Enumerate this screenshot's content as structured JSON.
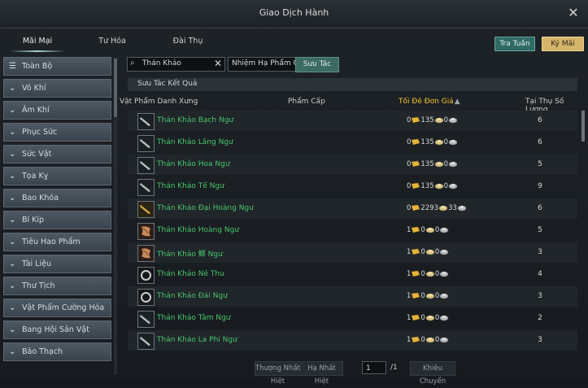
{
  "window": {
    "title": "Giao Dịch Hành",
    "close": "✕"
  },
  "tabs": [
    {
      "label": "Mãi Mại",
      "active": true
    },
    {
      "label": "Tư Hóa",
      "active": false
    },
    {
      "label": "Đài Thụ",
      "active": false
    }
  ],
  "top_buttons": {
    "tra_tuan": "Tra Tuần",
    "ky_mai": "Ký Mãi"
  },
  "sidebar": {
    "items": [
      {
        "label": "Toàn Bộ",
        "icon": "list-icon"
      },
      {
        "label": "Võ Khí",
        "icon": "chevron-down-icon"
      },
      {
        "label": "Âm Khí",
        "icon": "chevron-down-icon"
      },
      {
        "label": "Phục Sức",
        "icon": "chevron-down-icon"
      },
      {
        "label": "Sức Vật",
        "icon": "chevron-down-icon"
      },
      {
        "label": "Tọa Kỵ",
        "icon": "chevron-down-icon"
      },
      {
        "label": "Bao Khỏa",
        "icon": "chevron-down-icon"
      },
      {
        "label": "Bí Kíp",
        "icon": "chevron-down-icon"
      },
      {
        "label": "Tiêu Hao Phẩm",
        "icon": "chevron-down-icon"
      },
      {
        "label": "Tài Liệu",
        "icon": "chevron-down-icon"
      },
      {
        "label": "Thư Tịch",
        "icon": "chevron-down-icon"
      },
      {
        "label": "Vật Phẩm Cường Hóa",
        "icon": "chevron-down-icon"
      },
      {
        "label": "Bang Hội Sản Vật",
        "icon": "chevron-down-icon"
      },
      {
        "label": "Bảo Thạch",
        "icon": "chevron-down-icon"
      }
    ]
  },
  "search": {
    "value": "Thán Khảo",
    "clear": "✕",
    "filter": "Nhiệm Hạ Phẩm Ch",
    "button": "Sưu Tác"
  },
  "results": {
    "label": "Sưu Tác Kết Quả",
    "columns": {
      "item": "Vật Phẩm Danh Xưng",
      "grade": "Phẩm Cấp",
      "price": "Tối Đê Đơn Giá",
      "qty": "Tại Thụ Số Lượng"
    },
    "rows": [
      {
        "name": "Thán Khảo Bạch Ngư",
        "g": "0",
        "s": "135",
        "c": "0",
        "qty": "6",
        "icon": "sword-icon"
      },
      {
        "name": "Thán Khảo Lăng Ngư",
        "g": "0",
        "s": "135",
        "c": "0",
        "qty": "6",
        "icon": "sword-icon"
      },
      {
        "name": "Thán Khảo Hoa Ngư",
        "g": "0",
        "s": "135",
        "c": "0",
        "qty": "5",
        "icon": "sword-icon"
      },
      {
        "name": "Thán Khảo Tế Ngư",
        "g": "0",
        "s": "135",
        "c": "0",
        "qty": "9",
        "icon": "sword-icon"
      },
      {
        "name": "Thán Khảo Đại Hoàng Ngư",
        "g": "0",
        "s": "2293",
        "c": "33",
        "qty": "6",
        "icon": "gold-sword-icon"
      },
      {
        "name": "Thán Khảo Hoàng Ngư",
        "g": "1",
        "s": "0",
        "c": "0",
        "qty": "5",
        "icon": "scroll-icon"
      },
      {
        "name": "Thán Khảo 鲫 Ngư",
        "g": "1",
        "s": "0",
        "c": "0",
        "qty": "3",
        "icon": "scroll-icon"
      },
      {
        "name": "Thán Khảo Nê Thu",
        "g": "1",
        "s": "0",
        "c": "0",
        "qty": "4",
        "icon": "ring-icon"
      },
      {
        "name": "Thán Khảo Đái Ngư",
        "g": "1",
        "s": "0",
        "c": "0",
        "qty": "3",
        "icon": "ring-icon"
      },
      {
        "name": "Thán Khảo Tâm Ngư",
        "g": "1",
        "s": "0",
        "c": "0",
        "qty": "2",
        "icon": "sword-icon"
      },
      {
        "name": "Thán Khảo La Phi Ngư",
        "g": "1",
        "s": "0",
        "c": "0",
        "qty": "3",
        "icon": "sword-icon"
      }
    ]
  },
  "pager": {
    "prev": "Thượng Nhất Hiệt",
    "next": "Hạ Nhất Hiệt",
    "page": "1",
    "total": "/1",
    "jump": "Khiêu Chuyển"
  },
  "colors": {
    "accent": "#3c6a64",
    "gold_button": "#d4b56a",
    "item_green": "#49c56c",
    "sort_gold": "#f1c232"
  }
}
